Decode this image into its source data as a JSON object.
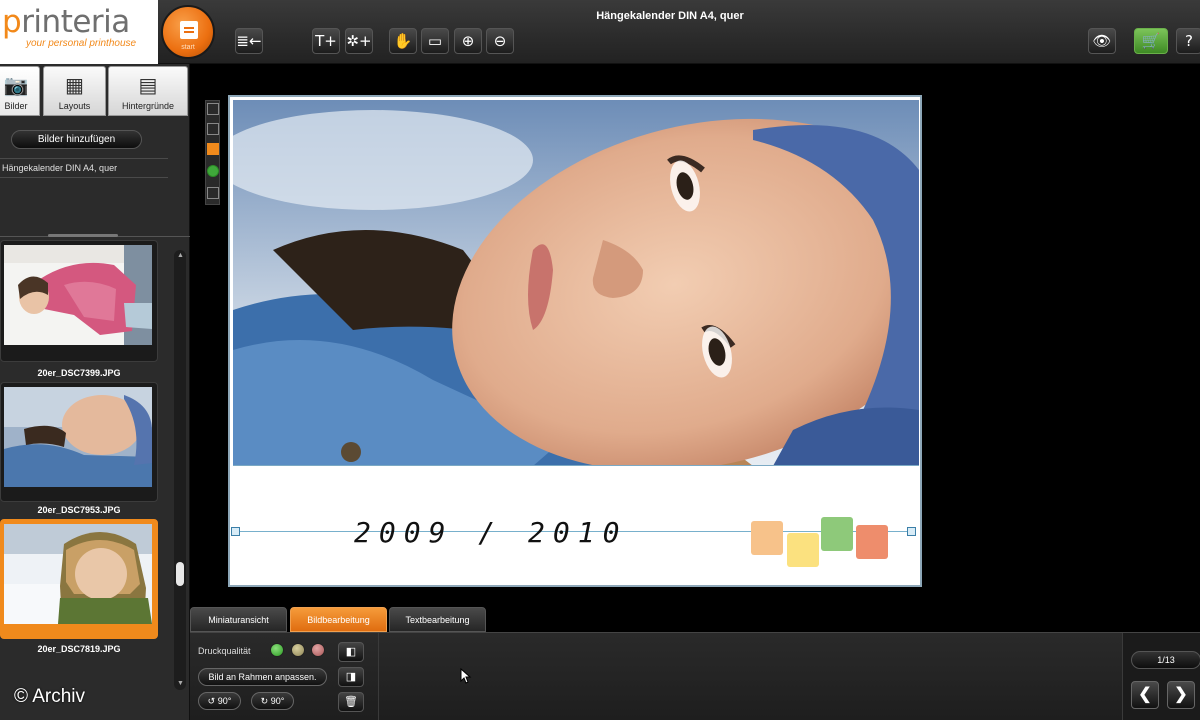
{
  "app": {
    "brand": "printeria",
    "tagline": "your personal printhouse",
    "home_small": "start",
    "title": "Hängekalender DIN A4, quer"
  },
  "toolbar": {
    "collapse": "≣←",
    "add_text": "T+",
    "add_clipart": "✲+",
    "hand": "✋",
    "fit": "▭",
    "zoom_in": "⊕",
    "zoom_out": "⊖",
    "preview": "👁",
    "cart": "🛒",
    "help": "?"
  },
  "left_panel": {
    "tabs": [
      {
        "label": "Bilder",
        "icon": "camera-icon",
        "glyph": "📷"
      },
      {
        "label": "Layouts",
        "icon": "layouts-icon",
        "glyph": "▦"
      },
      {
        "label": "Hintergründe",
        "icon": "backgrounds-icon",
        "glyph": "▤"
      }
    ],
    "add_images_label": "Bilder hinzufügen",
    "project_name": "Hängekalender DIN A4, quer",
    "thumbnails": [
      {
        "filename": "20er_DSC7399.JPG",
        "selected": false
      },
      {
        "filename": "20er_DSC7953.JPG",
        "selected": false
      },
      {
        "filename": "20er_DSC7819.JPG",
        "selected": true
      }
    ]
  },
  "canvas": {
    "year_text": "2009 / 2010",
    "accent_colors": [
      "#f7c28a",
      "#fbe17f",
      "#8ec97a",
      "#ee8d6c"
    ]
  },
  "bottom_tabs": [
    {
      "label": "Miniaturansicht",
      "active": false
    },
    {
      "label": "Bildbearbeitung",
      "active": true
    },
    {
      "label": "Textbearbeitung",
      "active": false
    }
  ],
  "bottom_panel": {
    "print_quality_label": "Druckqualität",
    "fit_frame_label": "Bild an Rahmen anpassen.",
    "rotate_left_label": "↺ 90°",
    "rotate_right_label": "↻ 90°"
  },
  "pager": {
    "counter": "1/13",
    "prev": "❮",
    "next": "❯"
  },
  "watermark": "© Archiv",
  "colors": {
    "accent": "#f08a1c",
    "cart_green": "#5aa83a"
  }
}
